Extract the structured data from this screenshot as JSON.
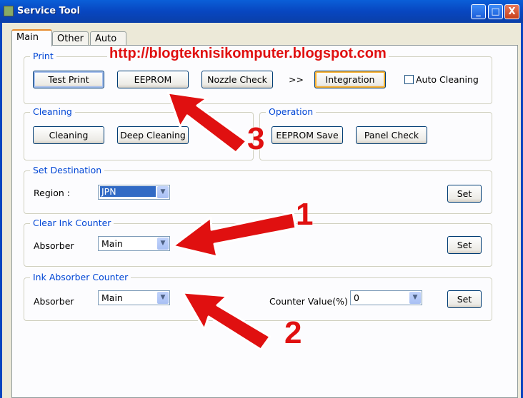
{
  "window": {
    "title": "Service Tool",
    "min": "_",
    "max": "□",
    "close": "X"
  },
  "tabs": [
    {
      "label": "Main"
    },
    {
      "label": "Other"
    },
    {
      "label": "Auto"
    }
  ],
  "print": {
    "legend": "Print",
    "test_print": "Test Print",
    "eeprom": "EEPROM",
    "nozzle_check": "Nozzle Check",
    "more": ">>",
    "integration": "Integration",
    "auto_cleaning": "Auto Cleaning",
    "auto_cleaning_checked": false
  },
  "cleaning": {
    "legend": "Cleaning",
    "cleaning": "Cleaning",
    "deep_cleaning": "Deep Cleaning"
  },
  "operation": {
    "legend": "Operation",
    "eeprom_save": "EEPROM Save",
    "panel_check": "Panel Check"
  },
  "destination": {
    "legend": "Set Destination",
    "region_label": "Region :",
    "region_value": "JPN",
    "set": "Set"
  },
  "clear_ink": {
    "legend": "Clear Ink Counter",
    "absorber_label": "Absorber",
    "absorber_value": "Main",
    "set": "Set"
  },
  "ink_absorber": {
    "legend": "Ink Absorber Counter",
    "absorber_label": "Absorber",
    "absorber_value": "Main",
    "counter_label": "Counter Value(%)",
    "counter_value": "0",
    "set": "Set"
  },
  "annotations": {
    "url": "http://blogteknisikomputer.blogspot.com",
    "n1": "1",
    "n2": "2",
    "n3": "3",
    "color": "#E01010"
  }
}
